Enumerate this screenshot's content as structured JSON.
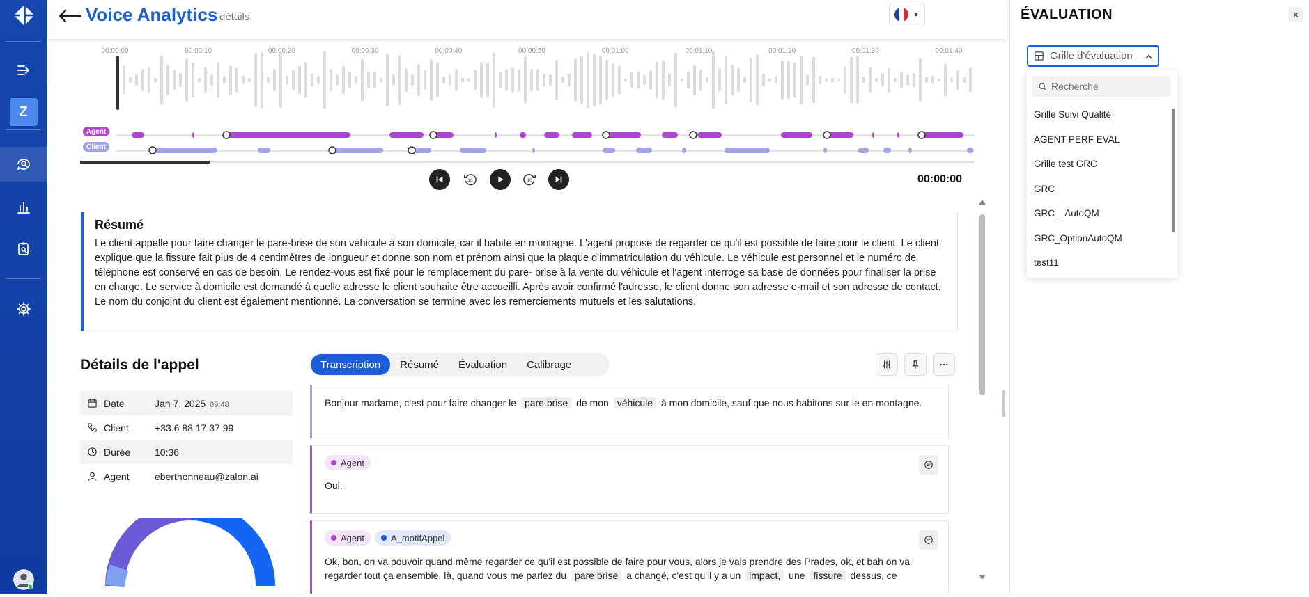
{
  "header": {
    "back_icon": "arrow-left-icon",
    "title": "Voice Analytics",
    "subtitle": "détails",
    "language_flag": "france-flag-icon"
  },
  "sidebar": {
    "logo": "brand-logo-icon",
    "items": [
      {
        "icon": "expand-icon"
      },
      {
        "icon": "workspace-avatar",
        "label": "Z"
      },
      {
        "icon": "chat-search-icon"
      },
      {
        "icon": "bar-chart-icon"
      },
      {
        "icon": "clipboard-search-icon"
      },
      {
        "icon": "gear-icon"
      },
      {
        "icon": "user-avatar-icon"
      }
    ]
  },
  "timeline": {
    "ticks": [
      "00:00:00",
      "00:00:10",
      "00:00:20",
      "00:00:30",
      "00:00:40",
      "00:00:50",
      "00:01:00",
      "00:01:10",
      "00:01:20",
      "00:01:30",
      "00:01:40"
    ],
    "lanes": [
      {
        "label": "Agent",
        "color": "#b142d6"
      },
      {
        "label": "Client",
        "color": "#a3a3e8"
      }
    ],
    "progress": 0.145
  },
  "player": {
    "buttons": [
      "skip-back-icon",
      "rewind-10-icon",
      "play-icon",
      "forward-10-icon",
      "skip-forward-icon"
    ],
    "time": "00:00:00"
  },
  "summary": {
    "title": "Résumé",
    "text": "Le client appelle pour faire changer le pare-brise de son véhicule à son domicile, car il habite en montagne. L'agent propose de regarder ce qu'il est possible de faire pour le client. Le client explique que la fissure fait plus de 4 centimètres de longueur et donne son nom et prénom ainsi que la plaque d'immatriculation du véhicule. Le véhicule est personnel et le numéro de téléphone est conservé en cas de besoin. Le rendez-vous est fixé pour le remplacement du pare- brise à la vente du véhicule et l'agent interroge sa base de données pour finaliser la prise en charge. Le service à domicile est demandé à quelle adresse le client souhaite être accueilli. Après avoir confirmé l'adresse, le client donne son adresse e-mail et son adresse de contact. Le nom du conjoint du client est également mentionné. La conversation se termine avec les remerciements mutuels et les salutations."
  },
  "details": {
    "title": "Détails de l'appel",
    "rows": [
      {
        "icon": "calendar-icon",
        "key": "Date",
        "value": "Jan 7, 2025",
        "extra": "09:48"
      },
      {
        "icon": "phone-icon",
        "key": "Client",
        "value": "+33 6 88 17 37 99",
        "extra": ""
      },
      {
        "icon": "clock-icon",
        "key": "Durée",
        "value": "10:36",
        "extra": ""
      },
      {
        "icon": "person-icon",
        "key": "Agent",
        "value": "eberthonneau@zalon.ai",
        "extra": ""
      }
    ]
  },
  "tabs": {
    "items": [
      "Transcription",
      "Résumé",
      "Évaluation",
      "Calibrage"
    ],
    "active": 0
  },
  "tools": [
    "sliders-icon",
    "pin-icon",
    "more-icon"
  ],
  "transcript": {
    "messages": [
      {
        "speaker": "client",
        "segments": [
          {
            "t": "Bonjour madame, c'est pour faire changer le"
          },
          {
            "kw": "pare brise"
          },
          {
            "t": "de mon"
          },
          {
            "kw": "véhicule"
          },
          {
            "t": "à mon domicile, sauf que nous habitons sur le en montagne."
          }
        ]
      },
      {
        "speaker": "agent",
        "chips": [
          {
            "label": "Agent",
            "color": "#b142d6",
            "bg": "#f3e4f8"
          }
        ],
        "segments": [
          {
            "t": "Oui."
          }
        ]
      },
      {
        "speaker": "agent",
        "chips": [
          {
            "label": "Agent",
            "color": "#b142d6",
            "bg": "#f3e4f8"
          },
          {
            "label": "A_motifAppel",
            "color": "#1a5ed8",
            "bg": "#e1e9f8"
          }
        ],
        "segments": [
          {
            "t": "Ok, bon, on va pouvoir quand même regarder ce qu'il est possible de faire pour vous, alors je vais prendre des Prades, ok, et bah on va regarder tout ça ensemble, là, quand vous me parlez du"
          },
          {
            "kw": "pare brise"
          },
          {
            "t": "a changé, c'est qu'il y a un"
          },
          {
            "kw": "impact,"
          },
          {
            "t": "une"
          },
          {
            "kw": "fissure"
          },
          {
            "t": "dessus, ce"
          }
        ]
      }
    ]
  },
  "right_panel": {
    "title": "ÉVALUATION",
    "close_label": "×",
    "select_label": "Grille d'évaluation",
    "search_placeholder": "Recherche",
    "options": [
      "Grille Suivi Qualité",
      "AGENT PERF EVAL",
      "Grille test GRC",
      "GRC",
      "GRC _ AutoQM",
      "GRC_OptionAutoQM",
      "test11"
    ]
  },
  "colors": {
    "brand": "#1a5ed8",
    "sidebar": "#1646b0",
    "agent": "#b142d6",
    "client": "#a3a3e8",
    "gauge_primary": "#1565f5",
    "gauge_secondary": "#6b5bd6"
  }
}
